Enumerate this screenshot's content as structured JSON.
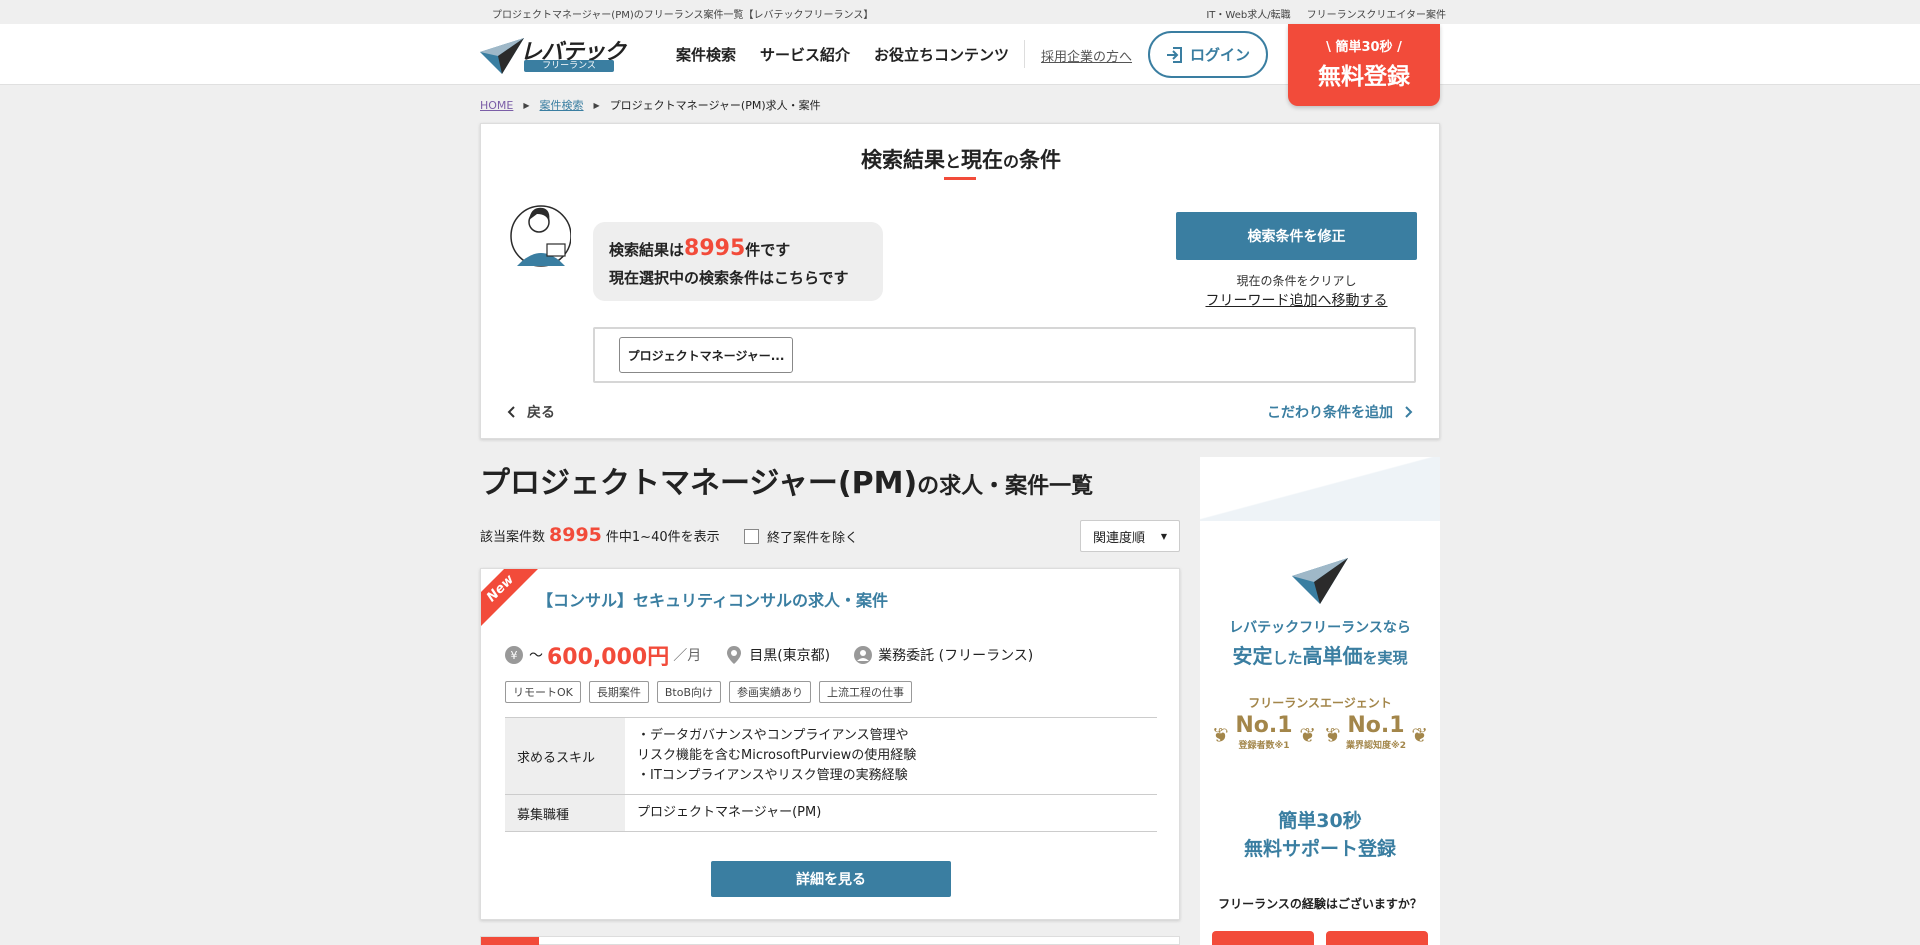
{
  "topbar": {
    "description": "プロジェクトマネージャー(PM)のフリーランス案件一覧【レバテックフリーランス】",
    "links": [
      "IT・Web求人/転職",
      "フリーランスクリエイター案件"
    ]
  },
  "header": {
    "logo_text": "レバテック",
    "logo_sub": "フリーランス",
    "nav": [
      "案件検索",
      "サービス紹介",
      "お役立ちコンテンツ"
    ],
    "corp_link": "採用企業の方へ",
    "login": "ログイン",
    "register_small": "\\ 簡単30秒 /",
    "register_big": "無料登録"
  },
  "breadcrumb": [
    "HOME",
    "案件検索",
    "プロジェクトマネージャー(PM)求人・案件"
  ],
  "search_panel": {
    "title_a": "検索結果",
    "title_b": "と",
    "title_c": "現在",
    "title_d": "の",
    "title_e": "条件",
    "bubble_pre": "検索結果は",
    "bubble_num": "8995",
    "bubble_post": "件です",
    "bubble_line2": "現在選択中の検索条件はこちらです",
    "modify_label": "検索条件を修正",
    "clear_note": "現在の条件をクリアし",
    "freeword_link": "フリーワード追加へ移動する",
    "condition_chip": "プロジェクトマネージャー...",
    "back_label": "戻る",
    "add_condition": "こだわり条件を追加"
  },
  "list": {
    "title_main": "プロジェクトマネージャー(PM)",
    "title_suffix": "の求人・案件一覧",
    "count_pre": "該当案件数",
    "count_num": "8995",
    "count_post": "件中1~40件を表示",
    "exclude_label": "終了案件を除く",
    "sort_label": "関連度順"
  },
  "job": {
    "badge": "New",
    "title": "【コンサル】セキュリティコンサルの求人・案件",
    "salary_prefix": "～",
    "salary": "600,000円",
    "salary_unit": "／月",
    "location": "目黒(東京都)",
    "contract": "業務委託 (フリーランス)",
    "tags": [
      "リモートOK",
      "長期案件",
      "BtoB向け",
      "参画実績あり",
      "上流工程の仕事"
    ],
    "skills_label": "求めるスキル",
    "skills_lines": [
      "・データガバナンスやコンプライアンス管理や",
      "リスク機能を含むMicrosoftPurviewの使用経験",
      "・ITコンプライアンスやリスク管理の実務経験"
    ],
    "role_label": "募集職種",
    "role_value": "プロジェクトマネージャー(PM)",
    "detail_button": "詳細を見る"
  },
  "side_ad": {
    "line1": "レバテックフリーランスなら",
    "line2_a": "安定",
    "line2_b": "した",
    "line2_c": "高単価",
    "line2_d": "を実現",
    "agent_label": "フリーランスエージェント",
    "award1_big": "No.1",
    "award1_small": "登録者数※1",
    "award2_big": "No.1",
    "award2_small": "業界認知度※2",
    "register_line1": "簡単30秒",
    "register_line2": "無料サポート登録",
    "question": "フリーランスの経験はございますか？"
  },
  "colors": {
    "accent": "#3a7ea1",
    "brand_red": "#f24b3a",
    "gold": "#a3864a"
  }
}
